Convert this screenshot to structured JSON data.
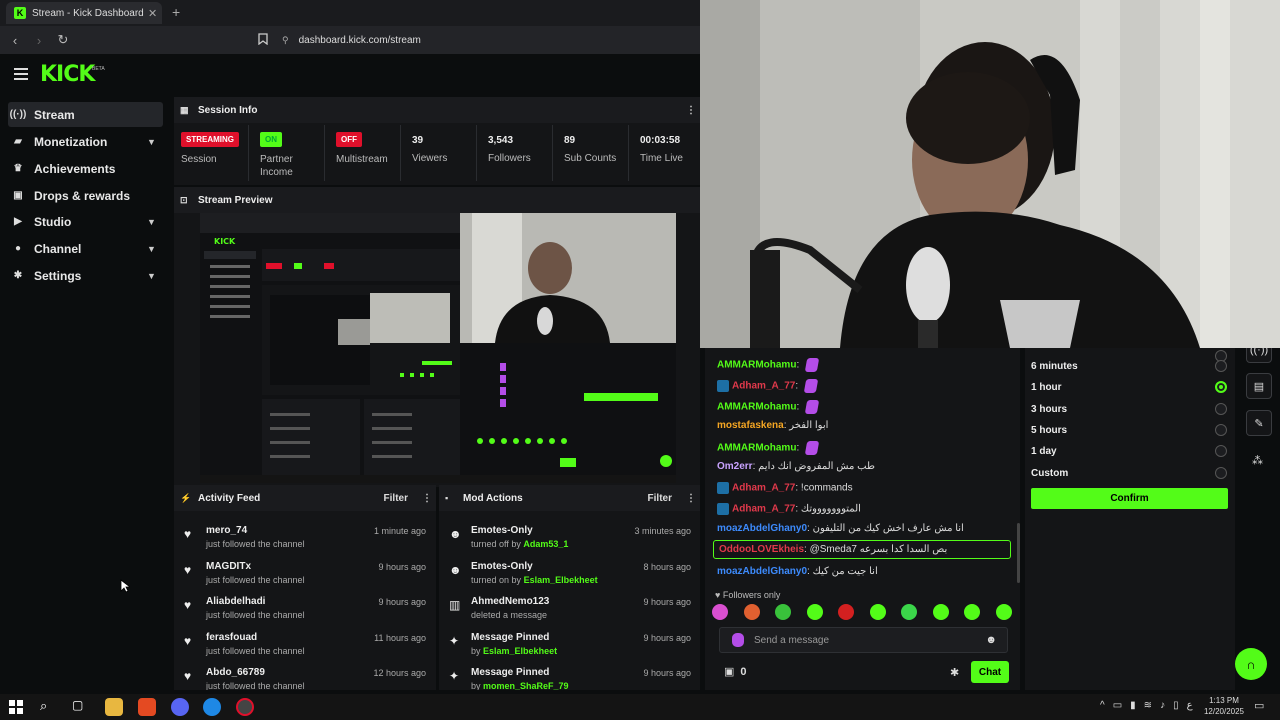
{
  "browser": {
    "tab_title": "Stream - Kick Dashboard",
    "url": "dashboard.kick.com/stream"
  },
  "header": {
    "logo": "KICK",
    "beta": "BETA"
  },
  "sidebar": {
    "items": [
      {
        "label": "Stream",
        "icon": "radio-icon"
      },
      {
        "label": "Monetization",
        "icon": "dollar-icon"
      },
      {
        "label": "Achievements",
        "icon": "trophy-icon"
      },
      {
        "label": "Drops & rewards",
        "icon": "gift-icon"
      },
      {
        "label": "Studio",
        "icon": "video-icon"
      },
      {
        "label": "Channel",
        "icon": "user-icon"
      },
      {
        "label": "Settings",
        "icon": "gear-icon"
      }
    ]
  },
  "session_info": {
    "title": "Session Info",
    "session": {
      "badge": "STREAMING",
      "label": "Session"
    },
    "partner": {
      "badge": "ON",
      "label": "Partner Income"
    },
    "multistream": {
      "badge": "OFF",
      "label": "Multistream"
    },
    "viewers": {
      "value": "39",
      "label": "Viewers"
    },
    "followers": {
      "value": "3,543",
      "label": "Followers"
    },
    "subs": {
      "value": "89",
      "label": "Sub Counts"
    },
    "time": {
      "value": "00:03:58",
      "label": "Time Live"
    }
  },
  "preview": {
    "title": "Stream Preview"
  },
  "activity_feed": {
    "title": "Activity Feed",
    "filter": "Filter",
    "items": [
      {
        "name": "mero_74",
        "sub": "just followed the channel",
        "time": "1 minute ago"
      },
      {
        "name": "MAGDITx",
        "sub": "just followed the channel",
        "time": "9 hours ago"
      },
      {
        "name": "Aliabdelhadi",
        "sub": "just followed the channel",
        "time": "9 hours ago"
      },
      {
        "name": "ferasfouad",
        "sub": "just followed the channel",
        "time": "11 hours ago"
      },
      {
        "name": "Abdo_66789",
        "sub": "just followed the channel",
        "time": "12 hours ago"
      }
    ]
  },
  "mod_actions": {
    "title": "Mod Actions",
    "filter": "Filter",
    "items": [
      {
        "name": "Emotes-Only",
        "sub": "turned off by",
        "user": "Adam53_1",
        "time": "3 minutes ago"
      },
      {
        "name": "Emotes-Only",
        "sub": "turned on by",
        "user": "Eslam_Elbekheet",
        "time": "8 hours ago"
      },
      {
        "name": "AhmedNemo123",
        "sub": "deleted a message",
        "user": "",
        "time": "9 hours ago"
      },
      {
        "name": "Message Pinned",
        "sub": "by",
        "user": "Eslam_Elbekheet",
        "time": "9 hours ago"
      },
      {
        "name": "Message Pinned",
        "sub": "by",
        "user": "momen_ShaReF_79",
        "time": "9 hours ago"
      }
    ]
  },
  "chat": {
    "messages": [
      {
        "user": "AMMARMohamu",
        "color": "#53fc18",
        "text": "",
        "emote": true,
        "badge": false
      },
      {
        "user": "Adham_A_77",
        "color": "#e0394b",
        "text": "",
        "emote": true,
        "badge": true
      },
      {
        "user": "AMMARMohamu",
        "color": "#53fc18",
        "text": "",
        "emote": true,
        "badge": false
      },
      {
        "user": "mostafaskena",
        "color": "#f5a623",
        "text": "ابوا الفخر",
        "emote": false,
        "badge": false
      },
      {
        "user": "AMMARMohamu",
        "color": "#53fc18",
        "text": "",
        "emote": true,
        "badge": false
      },
      {
        "user": "Om2err",
        "color": "#c9a3ff",
        "text": "طب مش المفروض انك دايم",
        "emote": false,
        "badge": false
      },
      {
        "user": "Adham_A_77",
        "color": "#e0394b",
        "text": "!commands",
        "emote": false,
        "badge": true
      },
      {
        "user": "Adham_A_77",
        "color": "#e0394b",
        "text": "المتوووووووتك",
        "emote": false,
        "badge": true
      },
      {
        "user": "moazAbdelGhany0",
        "color": "#3d8bfd",
        "text": "انا مش عارف اخش كيك من التليفون",
        "emote": false,
        "badge": false
      },
      {
        "user": "OddooLOVEkheis",
        "color": "#e0394b",
        "text": "@Smeda7 بص السدا كدا بسرعه",
        "emote": false,
        "badge": false,
        "highlight": true
      },
      {
        "user": "moazAbdelGhany0",
        "color": "#3d8bfd",
        "text": "انا جيت من كيك",
        "emote": false,
        "badge": false
      }
    ],
    "followers_only": "Followers only",
    "placeholder": "Send a message",
    "count": "0",
    "send": "Chat"
  },
  "durations": {
    "options": [
      {
        "label": "6 minutes",
        "selected": false
      },
      {
        "label": "1 hour",
        "selected": true
      },
      {
        "label": "3 hours",
        "selected": false
      },
      {
        "label": "5 hours",
        "selected": false
      },
      {
        "label": "1 day",
        "selected": false
      },
      {
        "label": "Custom",
        "selected": false
      }
    ],
    "confirm": "Confirm"
  },
  "taskbar": {
    "time": "1:13 PM",
    "date": "12/20/2025",
    "lang": "ع"
  },
  "colors": {
    "accent": "#53fc18",
    "danger": "#e0102b"
  }
}
